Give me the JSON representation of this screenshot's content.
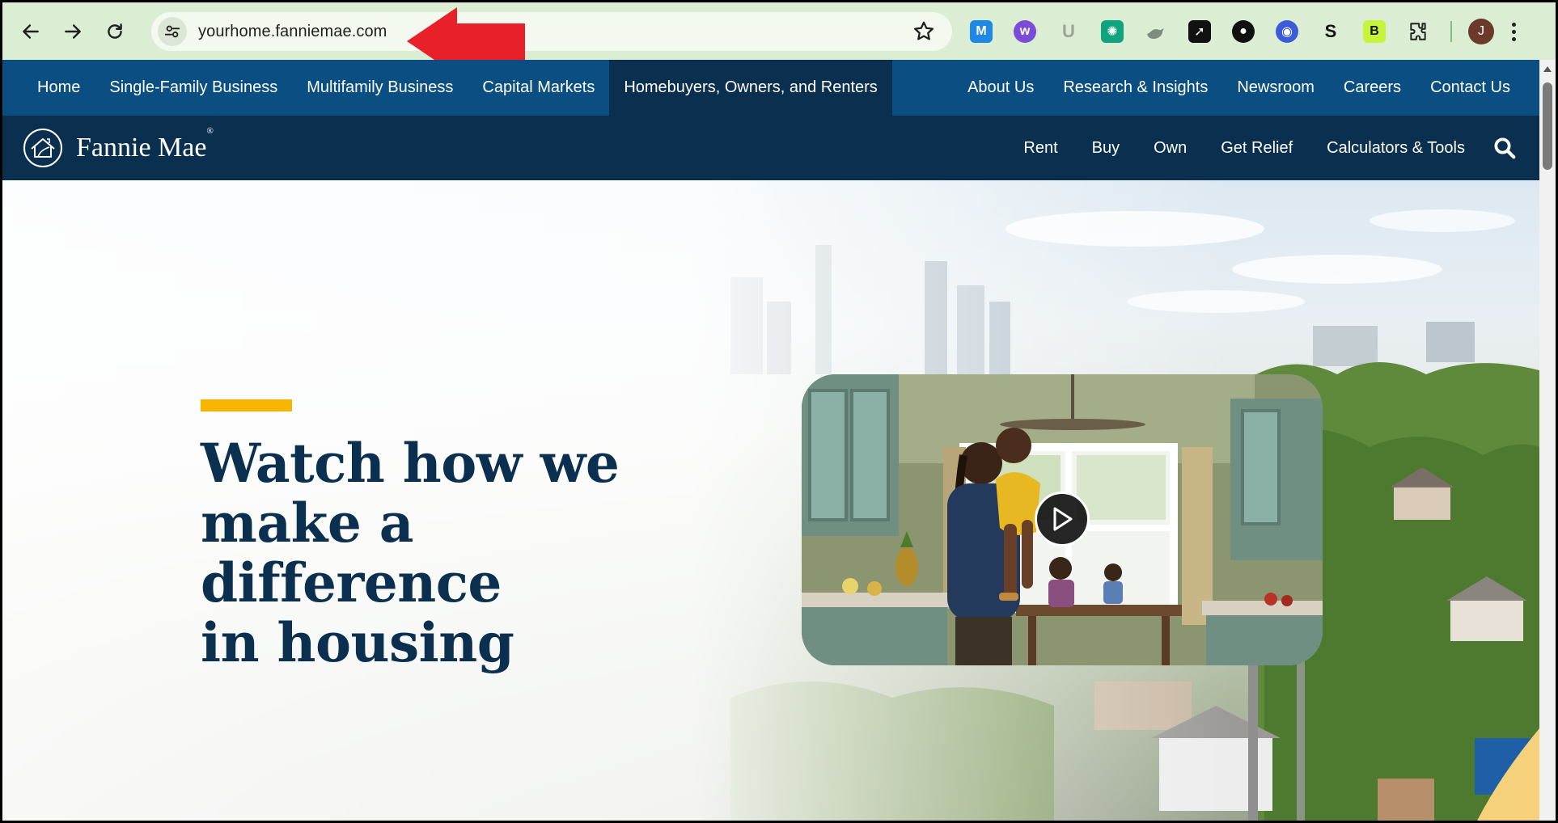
{
  "browser": {
    "url": "yourhome.fanniemae.com",
    "avatar_initial": "J",
    "extensions": [
      {
        "name": "m-extension-icon",
        "glyph": "M",
        "color": "#1e88e5"
      },
      {
        "name": "w-extension-icon",
        "glyph": "w",
        "color": "#7b4dd6"
      },
      {
        "name": "u-extension-icon",
        "glyph": "U",
        "color": "#9aa39a"
      },
      {
        "name": "chatgpt-extension-icon",
        "glyph": "✺",
        "color": "#10a37f"
      },
      {
        "name": "bird-extension-icon",
        "glyph": "",
        "color": "#7d8c7d"
      },
      {
        "name": "send-extension-icon",
        "glyph": "➚",
        "color": "#111111"
      },
      {
        "name": "dot-extension-icon",
        "glyph": "●",
        "color": "#111111"
      },
      {
        "name": "circle-extension-icon",
        "glyph": "◉",
        "color": "#3b5bdb"
      },
      {
        "name": "shield-extension-icon",
        "glyph": "S",
        "color": "#111111"
      },
      {
        "name": "b-extension-icon",
        "glyph": "B",
        "color": "#c6f43a"
      }
    ]
  },
  "top_nav": {
    "left": [
      "Home",
      "Single-Family Business",
      "Multifamily Business",
      "Capital Markets",
      "Homebuyers, Owners, and Renters"
    ],
    "right": [
      "About Us",
      "Research & Insights",
      "Newsroom",
      "Careers",
      "Contact Us"
    ]
  },
  "main_nav": {
    "logo_text": "Fannie Mae",
    "logo_mark": "®",
    "links": [
      "Rent",
      "Buy",
      "Own",
      "Get Relief",
      "Calculators & Tools"
    ]
  },
  "hero": {
    "title_line1": "Watch how we",
    "title_line2": "make a difference",
    "title_line3": "in housing"
  },
  "colors": {
    "top_nav_bg": "#0b4f82",
    "main_nav_bg": "#0a2f4f",
    "accent": "#f7b500",
    "chrome_bg": "#dbeed3"
  }
}
